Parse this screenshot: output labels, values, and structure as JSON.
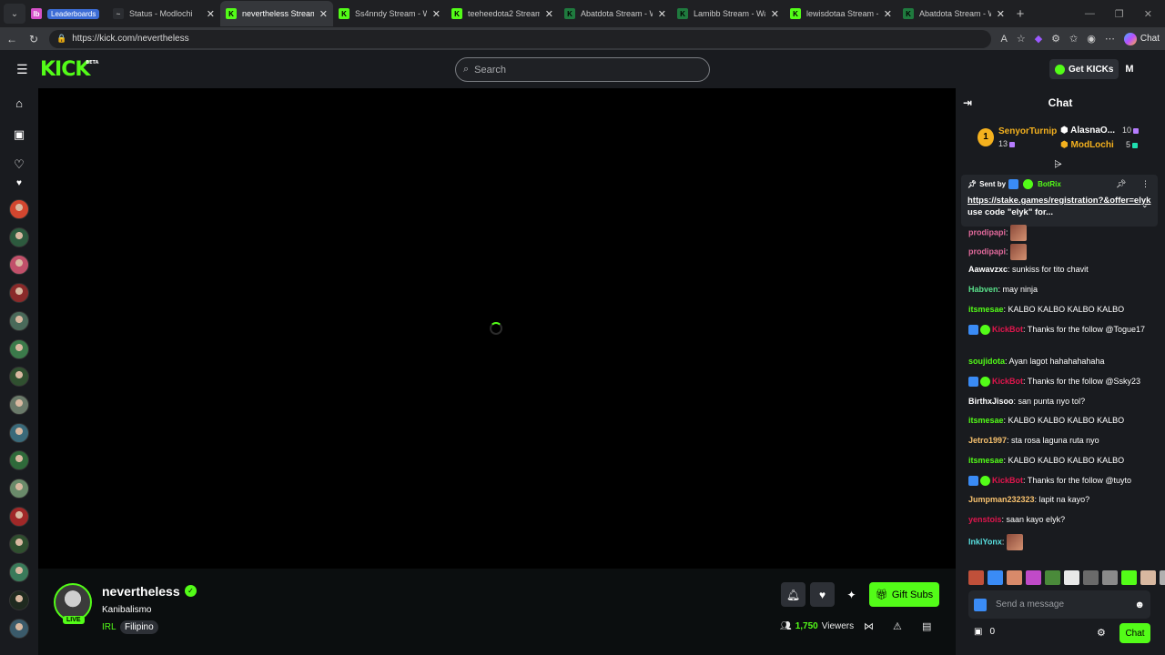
{
  "browser": {
    "tabs": [
      {
        "title": "Status - Modlochi",
        "fav_bg": "#2b2d31",
        "fav_txt": "~"
      },
      {
        "title": "nevertheless Stream - Wa",
        "fav_bg": "#53fc18",
        "fav_txt": "K",
        "active": true
      },
      {
        "title": "Ss4nndy Stream - W",
        "fav_bg": "#53fc18",
        "fav_txt": "K"
      },
      {
        "title": "teeheedota2 Stream",
        "fav_bg": "#53fc18",
        "fav_txt": "K"
      },
      {
        "title": "Abatdota Stream - Watc",
        "fav_bg": "#1f7a3e",
        "fav_txt": "K"
      },
      {
        "title": "Lamibb Stream - Watch",
        "fav_bg": "#1f7a3e",
        "fav_txt": "K"
      },
      {
        "title": "lewisdotaa Stream -",
        "fav_bg": "#53fc18",
        "fav_txt": "K"
      },
      {
        "title": "Abatdota Stream - Watc",
        "fav_bg": "#1f7a3e",
        "fav_txt": "K"
      }
    ],
    "leaderboards_tab": "Leaderboards",
    "url": "https://kick.com/nevertheless",
    "copilot_label": "Chat"
  },
  "header": {
    "logo": "KICK",
    "logo_sup": "BETA",
    "search_placeholder": "Search",
    "get_kicks": "Get KICKs",
    "user_initial": "M"
  },
  "stream": {
    "channel": "nevertheless",
    "live": "LIVE",
    "title": "Kanibalismo",
    "category": "IRL",
    "tag": "Filipino",
    "gift_subs": "Gift Subs",
    "viewers_count": "1,750",
    "viewers_label": "Viewers"
  },
  "chat": {
    "title": "Chat",
    "leaders": [
      {
        "rank": "1",
        "name": "SenyorTurnip",
        "count": "13",
        "color": "#f4b11e"
      },
      {
        "name": "AlasnaO...",
        "count": "10",
        "color": "#ffffff"
      },
      {
        "name": "ModLochi",
        "count": "5",
        "color": "#f4b11e"
      }
    ],
    "pinned": {
      "sent_by": "Sent by",
      "bot": "BotRix",
      "link": "https://stake.games/registration?&offer=elyk",
      "rest": "use code \"elyk\" for..."
    },
    "messages": [
      {
        "user": "prodipapi",
        "color": "#e0699b",
        "text": "",
        "emote": true
      },
      {
        "user": "prodipapi",
        "color": "#e0699b",
        "text": "",
        "emote": true
      },
      {
        "user": "Aawavzxc",
        "color": "#ffffff",
        "text": "sunkiss for tito chavit"
      },
      {
        "user": "Habven",
        "color": "#59e08a",
        "text": "may ninja"
      },
      {
        "user": "itsmesae",
        "color": "#53fc18",
        "text": "KALBO KALBO KALBO KALBO"
      },
      {
        "user": "KickBot",
        "color": "#e0164d",
        "text": "Thanks for the follow @Togue17",
        "bot": true
      },
      {
        "user": "soujidota",
        "color": "#53fc18",
        "text": "Ayan lagot hahahahahaha"
      },
      {
        "user": "KickBot",
        "color": "#e0164d",
        "text": "Thanks for the follow @Ssky23",
        "bot": true
      },
      {
        "user": "BirthxJisoo",
        "color": "#ffffff",
        "text": "san punta nyo tol?"
      },
      {
        "user": "itsmesae",
        "color": "#53fc18",
        "text": "KALBO KALBO KALBO KALBO"
      },
      {
        "user": "Jetro1997",
        "color": "#f7c16e",
        "text": "sta rosa laguna ruta nyo"
      },
      {
        "user": "itsmesae",
        "color": "#53fc18",
        "text": "KALBO KALBO KALBO KALBO"
      },
      {
        "user": "KickBot",
        "color": "#e0164d",
        "text": "Thanks for the follow @tuyto",
        "bot": true
      },
      {
        "user": "Jumpman232323",
        "color": "#f7c16e",
        "text": "lapit na kayo?"
      },
      {
        "user": "yenstois",
        "color": "#e0164d",
        "text": "saan kayo elyk?"
      },
      {
        "user": "InkiYonx",
        "color": "#59e0e0",
        "text": "",
        "emote": true
      }
    ],
    "input_placeholder": "Send a message",
    "gift_count": "0",
    "send_label": "Chat"
  },
  "colors": {
    "accent": "#53fc18",
    "bg": "#0b0e0f",
    "panel": "#191b1f"
  }
}
